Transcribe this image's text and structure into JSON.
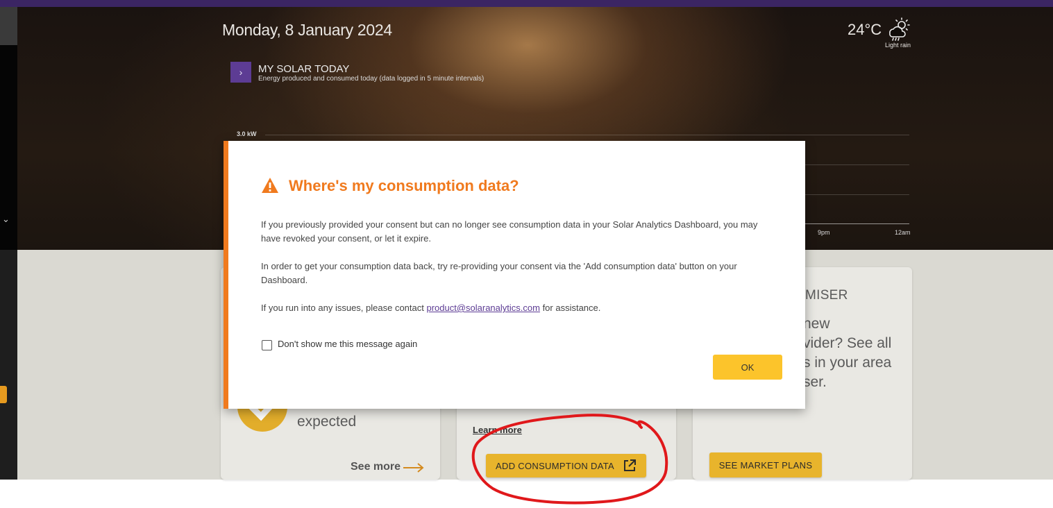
{
  "header": {
    "date": "Monday, 8 January 2024",
    "temperature": "24°C",
    "weather": "Light rain",
    "weather_icon": "rain-cloud-sun-icon"
  },
  "solar": {
    "toggle_icon": "chevron-right-icon",
    "title": "MY SOLAR TODAY",
    "subtitle": "Energy produced and consumed today (data logged in 5 minute intervals)"
  },
  "chart_data": {
    "type": "area",
    "ylabel": "3.0 kW",
    "x_ticks_visible": [
      "9pm",
      "12am"
    ],
    "grid": true
  },
  "cards": {
    "card1": {
      "body_visible": "expected",
      "see_more": "See more"
    },
    "card2": {
      "learn_more": "Learn more",
      "add_button": "ADD CONSUMPTION DATA"
    },
    "card3": {
      "title_visible": "MISER",
      "body_line1": "new",
      "body_line2": "vider? See all",
      "body_line3": "s in your area",
      "body_line4": "ser.",
      "button": "SEE MARKET PLANS"
    }
  },
  "modal": {
    "title": "Where's my consumption data?",
    "para1": "If you previously provided your consent but can no longer see consumption data in your Solar Analytics Dashboard, you may have revoked your consent, or let it expire.",
    "para2": "In order to get your consumption data back, try re-providing your consent via the 'Add consumption data' button on your Dashboard.",
    "para3_pre": "If you run into any issues, please contact ",
    "para3_link": "product@solaranalytics.com",
    "para3_post": " for assistance.",
    "checkbox_label": "Don't show me this message again",
    "ok": "OK"
  },
  "colors": {
    "accent_orange": "#f07a1e",
    "gold": "#e8b42c",
    "purple": "#5d3c94",
    "annotation_red": "#e0181b"
  }
}
